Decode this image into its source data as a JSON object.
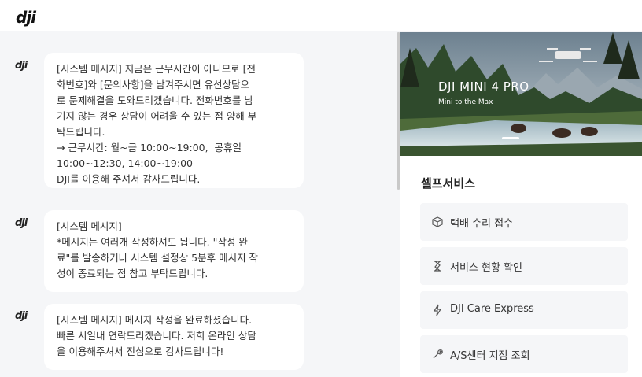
{
  "header": {
    "logo_text": "dji"
  },
  "messages": [
    {
      "avatar": "dji",
      "text": "[시스템 메시지] 지금은 근무시간이 아니므로 [전\n화번호]와 [문의사항]을 남겨주시면 유선상담으\n로 문제해결을 도와드리겠습니다. 전화번호를 남\n기지 않는 경우 상담이 어려울 수 있는 점 양해 부\n탁드립니다.\n→ 근무시간: 월~금 10:00~19:00,  공휴일\n10:00~12:30, 14:00~19:00\nDJI를 이용해 주셔서 감사드립니다."
    },
    {
      "avatar": "dji",
      "text": "[시스템 메시지]\n*메시지는 여러개 작성하셔도 됩니다. \"작성 완\n료\"를 발송하거나 시스템 설정상 5분후 메시지 작\n성이 종료되는 점 참고 부탁드립니다."
    },
    {
      "avatar": "dji",
      "text": "[시스템 메시지] 메시지 작성을 완료하셨습니다.\n빠른 시일내 연락드리겠습니다. 저희 온라인 상담\n을 이용해주셔서 진심으로 감사드립니다!"
    }
  ],
  "banner": {
    "title": "DJI MINI 4 PRO",
    "subtitle": "Mini to the Max"
  },
  "self_service": {
    "title": "셀프서비스",
    "items": [
      {
        "label": "택배 수리 접수",
        "icon": "box-icon"
      },
      {
        "label": "서비스 현황 확인",
        "icon": "hourglass-icon"
      },
      {
        "label": "DJI Care Express",
        "icon": "lightning-icon"
      },
      {
        "label": "A/S센터 지점 조회",
        "icon": "wrench-icon"
      }
    ]
  }
}
